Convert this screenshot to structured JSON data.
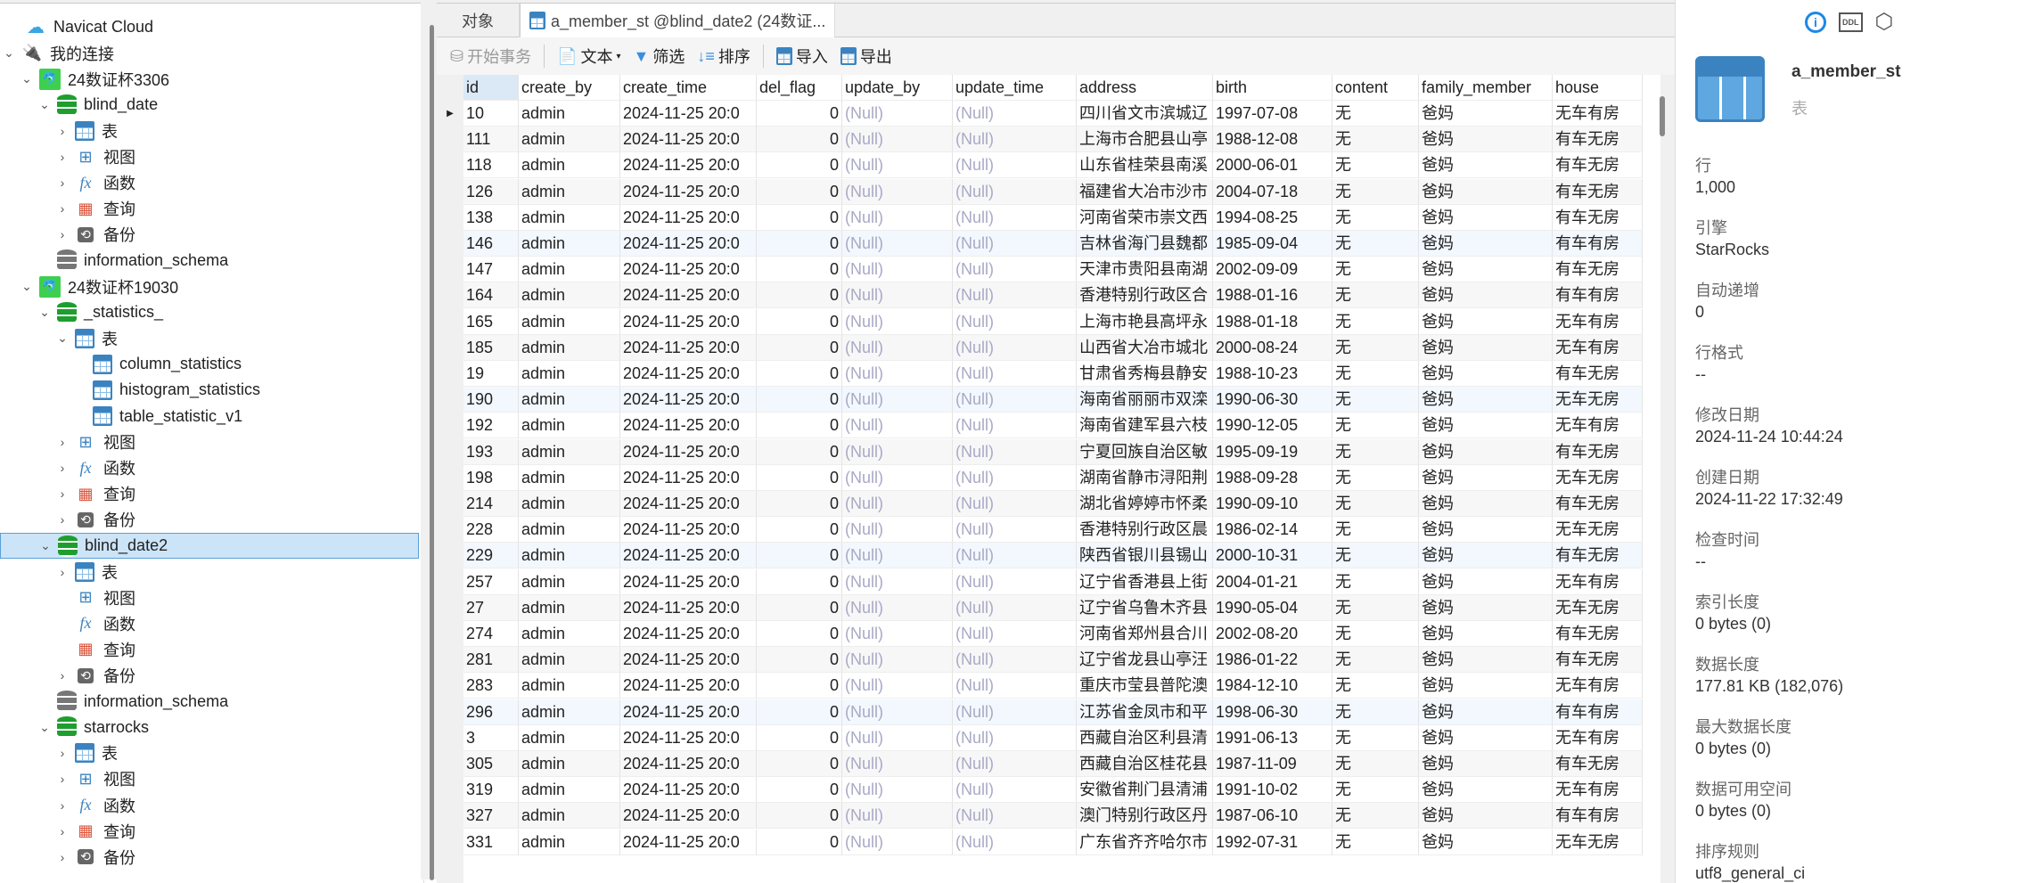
{
  "sidebar": {
    "items": [
      {
        "label": "Navicat Cloud",
        "level": 0,
        "icon": "cloud-icon",
        "exp": ""
      },
      {
        "label": "我的连接",
        "level": 0,
        "icon": "plug-icon",
        "exp": "v"
      },
      {
        "label": "24数证杯3306",
        "level": 1,
        "icon": "connection-icon",
        "exp": "v"
      },
      {
        "label": "blind_date",
        "level": 2,
        "icon": "database-icon",
        "exp": "v"
      },
      {
        "label": "表",
        "level": 3,
        "icon": "table-icon",
        "exp": ">"
      },
      {
        "label": "视图",
        "level": 3,
        "icon": "view-icon",
        "exp": ">"
      },
      {
        "label": "函数",
        "level": 3,
        "icon": "function-icon",
        "exp": ">"
      },
      {
        "label": "查询",
        "level": 3,
        "icon": "query-icon",
        "exp": ">"
      },
      {
        "label": "备份",
        "level": 3,
        "icon": "backup-icon",
        "exp": ">"
      },
      {
        "label": "information_schema",
        "level": 2,
        "icon": "database-grey-icon",
        "exp": ""
      },
      {
        "label": "24数证杯19030",
        "level": 1,
        "icon": "connection-icon",
        "exp": "v"
      },
      {
        "label": "_statistics_",
        "level": 2,
        "icon": "database-icon",
        "exp": "v"
      },
      {
        "label": "表",
        "level": 3,
        "icon": "table-icon",
        "exp": "v"
      },
      {
        "label": "column_statistics",
        "level": 4,
        "icon": "table-icon",
        "exp": ""
      },
      {
        "label": "histogram_statistics",
        "level": 4,
        "icon": "table-icon",
        "exp": ""
      },
      {
        "label": "table_statistic_v1",
        "level": 4,
        "icon": "table-icon",
        "exp": ""
      },
      {
        "label": "视图",
        "level": 3,
        "icon": "view-icon",
        "exp": ">"
      },
      {
        "label": "函数",
        "level": 3,
        "icon": "function-icon",
        "exp": ">"
      },
      {
        "label": "查询",
        "level": 3,
        "icon": "query-icon",
        "exp": ">"
      },
      {
        "label": "备份",
        "level": 3,
        "icon": "backup-icon",
        "exp": ">"
      },
      {
        "label": "blind_date2",
        "level": 2,
        "icon": "database-icon",
        "exp": "v",
        "selected": true
      },
      {
        "label": "表",
        "level": 3,
        "icon": "table-icon",
        "exp": ">"
      },
      {
        "label": "视图",
        "level": 3,
        "icon": "view-icon",
        "exp": ""
      },
      {
        "label": "函数",
        "level": 3,
        "icon": "function-icon",
        "exp": ""
      },
      {
        "label": "查询",
        "level": 3,
        "icon": "query-icon",
        "exp": ""
      },
      {
        "label": "备份",
        "level": 3,
        "icon": "backup-icon",
        "exp": ">"
      },
      {
        "label": "information_schema",
        "level": 2,
        "icon": "database-grey-icon",
        "exp": ""
      },
      {
        "label": "starrocks",
        "level": 2,
        "icon": "database-icon",
        "exp": "v"
      },
      {
        "label": "表",
        "level": 3,
        "icon": "table-icon",
        "exp": ">"
      },
      {
        "label": "视图",
        "level": 3,
        "icon": "view-icon",
        "exp": ">"
      },
      {
        "label": "函数",
        "level": 3,
        "icon": "function-icon",
        "exp": ">"
      },
      {
        "label": "查询",
        "level": 3,
        "icon": "query-icon",
        "exp": ">"
      },
      {
        "label": "备份",
        "level": 3,
        "icon": "backup-icon",
        "exp": ">"
      }
    ]
  },
  "tabs": {
    "objects": "对象",
    "active": "a_member_st @blind_date2 (24数证..."
  },
  "toolbar": {
    "begin_tx": "开始事务",
    "text": "文本",
    "filter": "筛选",
    "sort": "排序",
    "import": "导入",
    "export": "导出"
  },
  "grid": {
    "columns": [
      "id",
      "create_by",
      "create_time",
      "del_flag",
      "update_by",
      "update_time",
      "address",
      "birth",
      "content",
      "family_member",
      "house"
    ],
    "rows": [
      [
        "10",
        "admin",
        "2024-11-25 20:0",
        "0",
        "(Null)",
        "(Null)",
        "四川省文市滨城辽",
        "1997-07-08",
        "无",
        "爸妈",
        "无车有房"
      ],
      [
        "111",
        "admin",
        "2024-11-25 20:0",
        "0",
        "(Null)",
        "(Null)",
        "上海市合肥县山亭",
        "1988-12-08",
        "无",
        "爸妈",
        "有车无房"
      ],
      [
        "118",
        "admin",
        "2024-11-25 20:0",
        "0",
        "(Null)",
        "(Null)",
        "山东省桂荣县南溪",
        "2000-06-01",
        "无",
        "爸妈",
        "有车无房"
      ],
      [
        "126",
        "admin",
        "2024-11-25 20:0",
        "0",
        "(Null)",
        "(Null)",
        "福建省大冶市沙市",
        "2004-07-18",
        "无",
        "爸妈",
        "有车无房"
      ],
      [
        "138",
        "admin",
        "2024-11-25 20:0",
        "0",
        "(Null)",
        "(Null)",
        "河南省荣市崇文西",
        "1994-08-25",
        "无",
        "爸妈",
        "有车无房"
      ],
      [
        "146",
        "admin",
        "2024-11-25 20:0",
        "0",
        "(Null)",
        "(Null)",
        "吉林省海门县魏都",
        "1985-09-04",
        "无",
        "爸妈",
        "有车有房"
      ],
      [
        "147",
        "admin",
        "2024-11-25 20:0",
        "0",
        "(Null)",
        "(Null)",
        "天津市贵阳县南湖",
        "2002-09-09",
        "无",
        "爸妈",
        "有车无房"
      ],
      [
        "164",
        "admin",
        "2024-11-25 20:0",
        "0",
        "(Null)",
        "(Null)",
        "香港特别行政区合",
        "1988-01-16",
        "无",
        "爸妈",
        "有车有房"
      ],
      [
        "165",
        "admin",
        "2024-11-25 20:0",
        "0",
        "(Null)",
        "(Null)",
        "上海市艳县高坪永",
        "1988-01-18",
        "无",
        "爸妈",
        "无车有房"
      ],
      [
        "185",
        "admin",
        "2024-11-25 20:0",
        "0",
        "(Null)",
        "(Null)",
        "山西省大冶市城北",
        "2000-08-24",
        "无",
        "爸妈",
        "无车有房"
      ],
      [
        "19",
        "admin",
        "2024-11-25 20:0",
        "0",
        "(Null)",
        "(Null)",
        "甘肃省秀梅县静安",
        "1988-10-23",
        "无",
        "爸妈",
        "有车无房"
      ],
      [
        "190",
        "admin",
        "2024-11-25 20:0",
        "0",
        "(Null)",
        "(Null)",
        "海南省丽丽市双滦",
        "1990-06-30",
        "无",
        "爸妈",
        "无车无房"
      ],
      [
        "192",
        "admin",
        "2024-11-25 20:0",
        "0",
        "(Null)",
        "(Null)",
        "海南省建军县六枝",
        "1990-12-05",
        "无",
        "爸妈",
        "无车有房"
      ],
      [
        "193",
        "admin",
        "2024-11-25 20:0",
        "0",
        "(Null)",
        "(Null)",
        "宁夏回族自治区敏",
        "1995-09-19",
        "无",
        "爸妈",
        "有车无房"
      ],
      [
        "198",
        "admin",
        "2024-11-25 20:0",
        "0",
        "(Null)",
        "(Null)",
        "湖南省静市浔阳荆",
        "1988-09-28",
        "无",
        "爸妈",
        "无车无房"
      ],
      [
        "214",
        "admin",
        "2024-11-25 20:0",
        "0",
        "(Null)",
        "(Null)",
        "湖北省婷婷市怀柔",
        "1990-09-10",
        "无",
        "爸妈",
        "有车无房"
      ],
      [
        "228",
        "admin",
        "2024-11-25 20:0",
        "0",
        "(Null)",
        "(Null)",
        "香港特别行政区晨",
        "1986-02-14",
        "无",
        "爸妈",
        "无车无房"
      ],
      [
        "229",
        "admin",
        "2024-11-25 20:0",
        "0",
        "(Null)",
        "(Null)",
        "陕西省银川县锡山",
        "2000-10-31",
        "无",
        "爸妈",
        "有车无房"
      ],
      [
        "257",
        "admin",
        "2024-11-25 20:0",
        "0",
        "(Null)",
        "(Null)",
        "辽宁省香港县上街",
        "2004-01-21",
        "无",
        "爸妈",
        "无车有房"
      ],
      [
        "27",
        "admin",
        "2024-11-25 20:0",
        "0",
        "(Null)",
        "(Null)",
        "辽宁省乌鲁木齐县",
        "1990-05-04",
        "无",
        "爸妈",
        "无车无房"
      ],
      [
        "274",
        "admin",
        "2024-11-25 20:0",
        "0",
        "(Null)",
        "(Null)",
        "河南省郑州县合川",
        "2002-08-20",
        "无",
        "爸妈",
        "有车无房"
      ],
      [
        "281",
        "admin",
        "2024-11-25 20:0",
        "0",
        "(Null)",
        "(Null)",
        "辽宁省龙县山亭汪",
        "1986-01-22",
        "无",
        "爸妈",
        "有车无房"
      ],
      [
        "283",
        "admin",
        "2024-11-25 20:0",
        "0",
        "(Null)",
        "(Null)",
        "重庆市莹县普陀澳",
        "1984-12-10",
        "无",
        "爸妈",
        "无车有房"
      ],
      [
        "296",
        "admin",
        "2024-11-25 20:0",
        "0",
        "(Null)",
        "(Null)",
        "江苏省金凤市和平",
        "1998-06-30",
        "无",
        "爸妈",
        "有车有房"
      ],
      [
        "3",
        "admin",
        "2024-11-25 20:0",
        "0",
        "(Null)",
        "(Null)",
        "西藏自治区利县清",
        "1991-06-13",
        "无",
        "爸妈",
        "无车有房"
      ],
      [
        "305",
        "admin",
        "2024-11-25 20:0",
        "0",
        "(Null)",
        "(Null)",
        "西藏自治区桂花县",
        "1987-11-09",
        "无",
        "爸妈",
        "有车无房"
      ],
      [
        "319",
        "admin",
        "2024-11-25 20:0",
        "0",
        "(Null)",
        "(Null)",
        "安徽省荆门县清浦",
        "1991-10-02",
        "无",
        "爸妈",
        "无车有房"
      ],
      [
        "327",
        "admin",
        "2024-11-25 20:0",
        "0",
        "(Null)",
        "(Null)",
        "澳门特别行政区丹",
        "1987-06-10",
        "无",
        "爸妈",
        "有车有房"
      ],
      [
        "331",
        "admin",
        "2024-11-25 20:0",
        "0",
        "(Null)",
        "(Null)",
        "广东省齐齐哈尔市",
        "1992-07-31",
        "无",
        "爸妈",
        "无车无房"
      ]
    ]
  },
  "info": {
    "name": "a_member_st",
    "type": "表",
    "props": [
      {
        "label": "行",
        "value": "1,000"
      },
      {
        "label": "引擎",
        "value": "StarRocks"
      },
      {
        "label": "自动递增",
        "value": "0"
      },
      {
        "label": "行格式",
        "value": "--"
      },
      {
        "label": "修改日期",
        "value": "2024-11-24 10:44:24"
      },
      {
        "label": "创建日期",
        "value": "2024-11-22 17:32:49"
      },
      {
        "label": "检查时间",
        "value": "--"
      },
      {
        "label": "索引长度",
        "value": "0 bytes (0)"
      },
      {
        "label": "数据长度",
        "value": "177.81 KB (182,076)"
      },
      {
        "label": "最大数据长度",
        "value": "0 bytes (0)"
      },
      {
        "label": "数据可用空间",
        "value": "0 bytes (0)"
      },
      {
        "label": "排序规则",
        "value": "utf8_general_ci"
      }
    ],
    "ddl_label": "DDL"
  },
  "colors": {
    "accent": "#1e88e5",
    "table_icon": "#3b83c0",
    "db_green": "#1e9e2e"
  }
}
